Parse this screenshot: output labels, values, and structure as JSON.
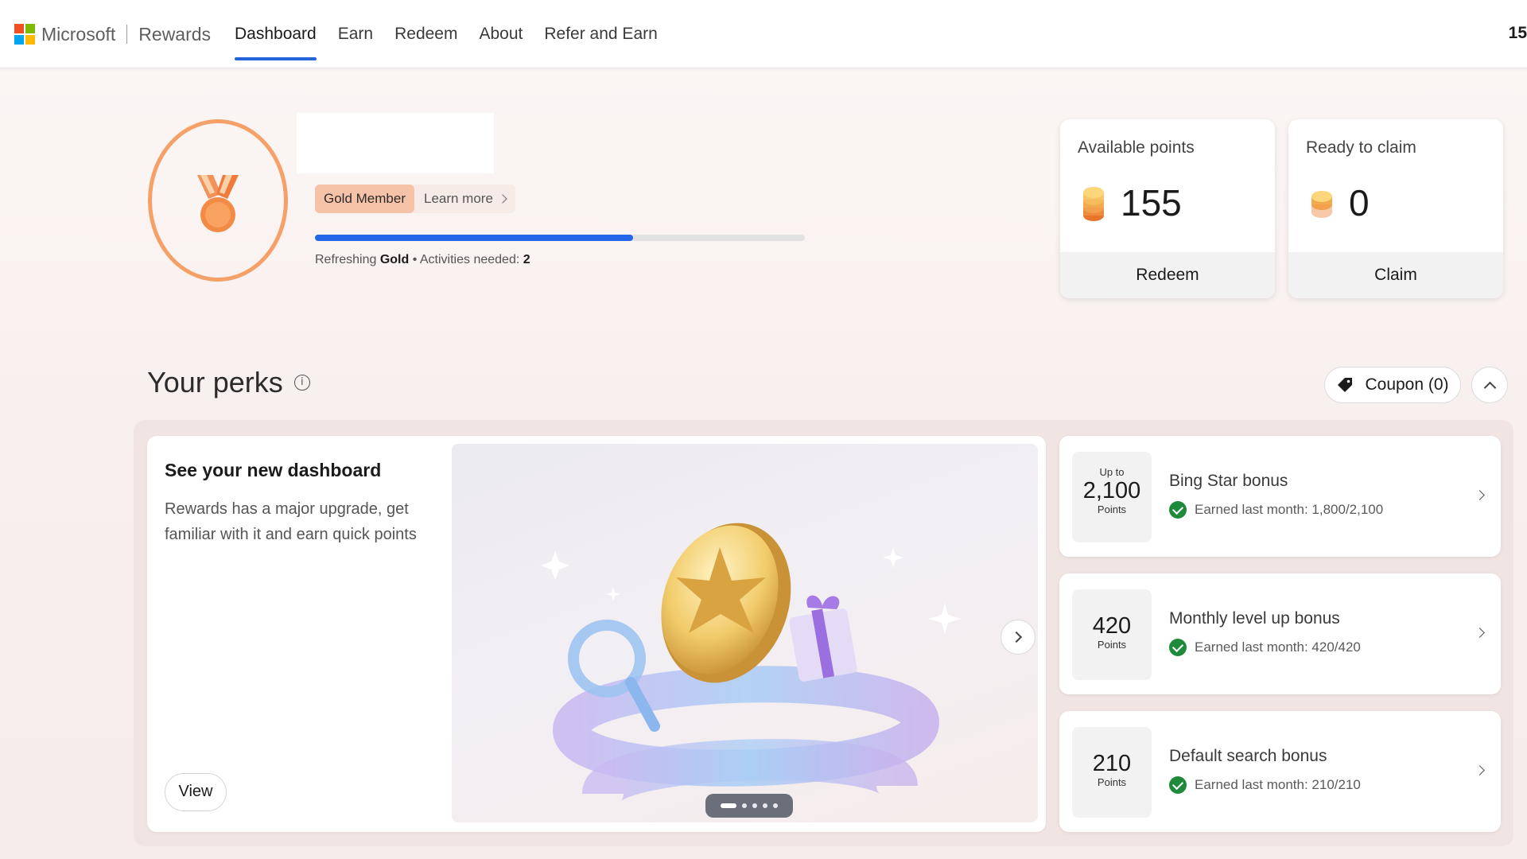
{
  "header": {
    "brand": "Microsoft",
    "product": "Rewards",
    "nav": [
      "Dashboard",
      "Earn",
      "Redeem",
      "About",
      "Refer and Earn"
    ],
    "active_nav": "Dashboard",
    "corner_value": "15"
  },
  "profile": {
    "level_badge": "Gold Member",
    "learn_more": "Learn more",
    "progress_fraction": 0.65,
    "status_prefix": "Refreshing",
    "status_level": "Gold",
    "status_sep": " • Activities needed: ",
    "activities_needed": "2"
  },
  "points": {
    "available_label": "Available points",
    "available_value": "155",
    "redeem_label": "Redeem",
    "ready_label": "Ready to claim",
    "ready_value": "0",
    "claim_label": "Claim"
  },
  "perks": {
    "title": "Your perks",
    "info_glyph": "i",
    "coupon_label": "Coupon (0)"
  },
  "dashboard_card": {
    "title": "See your new dashboard",
    "description": "Rewards has a major upgrade, get familiar with it and earn quick points",
    "view_label": "View",
    "slides_total": 5,
    "active_slide": 1
  },
  "bonuses": [
    {
      "top": "Up to",
      "value": "2,100",
      "unit": "Points",
      "title": "Bing Star bonus",
      "status": "Earned last month: 1,800/2,100"
    },
    {
      "top": "",
      "value": "420",
      "unit": "Points",
      "title": "Monthly level up bonus",
      "status": "Earned last month: 420/420"
    },
    {
      "top": "",
      "value": "210",
      "unit": "Points",
      "title": "Default search bonus",
      "status": "Earned last month: 210/210"
    }
  ],
  "colors": {
    "accent_blue": "#2566e8",
    "medal_orange": "#f5a066",
    "check_green": "#1f8a3b",
    "gold_badge": "#f7c3a8"
  }
}
